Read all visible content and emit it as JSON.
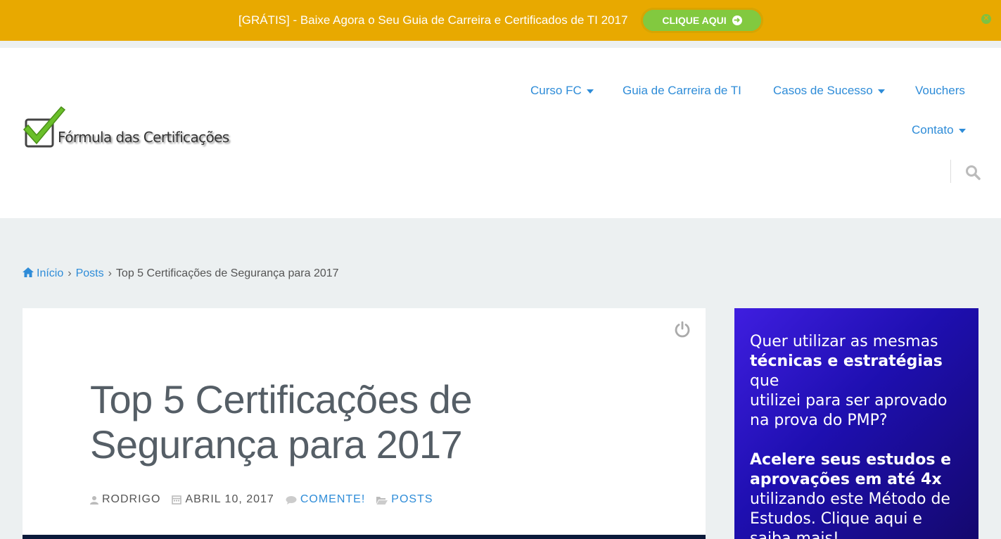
{
  "topbar": {
    "promo_text": "[GRÁTIS] - Baixe Agora o Seu Guia de Carreira e Certificados de TI 2017",
    "cta_label": "CLIQUE AQUI",
    "colors": {
      "background": "#e8a900",
      "cta": "#82c93f"
    }
  },
  "header": {
    "logo_text": "Fórmula das Certificações",
    "nav": [
      {
        "label": "Curso FC",
        "has_dropdown": true
      },
      {
        "label": "Guia de Carreira de TI",
        "has_dropdown": false
      },
      {
        "label": "Casos de Sucesso",
        "has_dropdown": true
      },
      {
        "label": "Vouchers",
        "has_dropdown": false
      },
      {
        "label": "Contato",
        "has_dropdown": true
      }
    ],
    "search_icon": "search-icon"
  },
  "breadcrumb": {
    "home": "Início",
    "posts": "Posts",
    "current": "Top 5 Certificações de Segurança para 2017"
  },
  "article": {
    "title": "Top 5 Certificações de Segurança para 2017",
    "author": "RODRIGO",
    "date": "ABRIL 10, 2017",
    "comments": "COMENTE!",
    "category": "POSTS"
  },
  "sidebar": {
    "line1": "Quer utilizar as mesmas",
    "line2_bold": "técnicas e estratégias",
    "line3": "que",
    "line4": "utilizei para ser aprovado",
    "line5": "na prova do PMP?",
    "bold1": "Acelere seus estudos e",
    "bold2": "aprovações em até 4x",
    "line6": "utilizando este Método de",
    "line7": "Estudos. Clique aqui e",
    "line8": "saiba mais!"
  }
}
